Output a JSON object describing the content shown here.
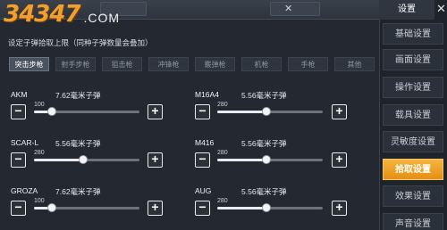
{
  "watermark": {
    "number": "34347",
    "domain": ".COM"
  },
  "section_title": "设定子弹拾取上限（同种子弹数量会叠加）",
  "top_strip": {
    "close_symbol": "✕"
  },
  "tabs": [
    {
      "label": "突击步枪",
      "active": true
    },
    {
      "label": "射手步枪",
      "active": false
    },
    {
      "label": "狙击枪",
      "active": false
    },
    {
      "label": "冲锋枪",
      "active": false
    },
    {
      "label": "霰弹枪",
      "active": false
    },
    {
      "label": "机枪",
      "active": false
    },
    {
      "label": "手枪",
      "active": false
    },
    {
      "label": "其他",
      "active": false
    }
  ],
  "weapons": [
    {
      "name": "AKM",
      "ammo": "7.62毫米子弹",
      "value": "100",
      "level": 0.17
    },
    {
      "name": "M16A4",
      "ammo": "5.56毫米子弹",
      "value": "280",
      "level": 0.47
    },
    {
      "name": "SCAR-L",
      "ammo": "5.56毫米子弹",
      "value": "280",
      "level": 0.47
    },
    {
      "name": "M416",
      "ammo": "5.56毫米子弹",
      "value": "280",
      "level": 0.47
    },
    {
      "name": "GROZA",
      "ammo": "7.62毫米子弹",
      "value": "100",
      "level": 0.17
    },
    {
      "name": "AUG",
      "ammo": "5.56毫米子弹",
      "value": "280",
      "level": 0.47
    }
  ],
  "controls": {
    "minus": "−",
    "plus": "+"
  },
  "sidebar": {
    "title": "设置",
    "close_symbol": "✕",
    "items": [
      {
        "label": "基础设置",
        "active": false
      },
      {
        "label": "画面设置",
        "active": false
      },
      {
        "label": "操作设置",
        "active": false
      },
      {
        "label": "载具设置",
        "active": false
      },
      {
        "label": "灵敏度设置",
        "active": false
      },
      {
        "label": "拾取设置",
        "active": true
      },
      {
        "label": "效果设置",
        "active": false
      },
      {
        "label": "声音设置",
        "active": false
      }
    ]
  },
  "colors": {
    "accent": "#f0a030",
    "active_tab_orange": "#e58f14",
    "background": "#232831"
  }
}
